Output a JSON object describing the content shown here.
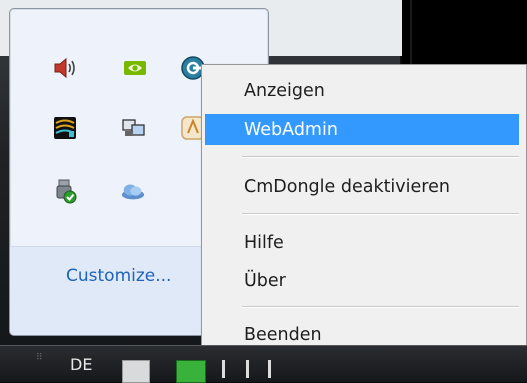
{
  "tray": {
    "customize_label": "Customize...",
    "icons": [
      {
        "name": "speaker-icon"
      },
      {
        "name": "nvidia-icon"
      },
      {
        "name": "codemeter-icon"
      },
      {
        "name": "network-monitor-icon"
      },
      {
        "name": "display-adapter-icon"
      },
      {
        "name": "app-icon"
      },
      {
        "name": "usb-safely-remove-icon"
      },
      {
        "name": "cloud-icon"
      }
    ]
  },
  "context_menu": {
    "items": [
      {
        "label": "Anzeigen",
        "highlighted": false
      },
      {
        "label": "WebAdmin",
        "highlighted": true
      },
      {
        "label": "CmDongle deaktivieren",
        "highlighted": false
      },
      {
        "label": "Hilfe",
        "highlighted": false
      },
      {
        "label": "Über",
        "highlighted": false
      },
      {
        "label": "Beenden",
        "highlighted": false
      }
    ],
    "highlight_color": "#3399ff"
  },
  "taskbar": {
    "language": "DE"
  }
}
